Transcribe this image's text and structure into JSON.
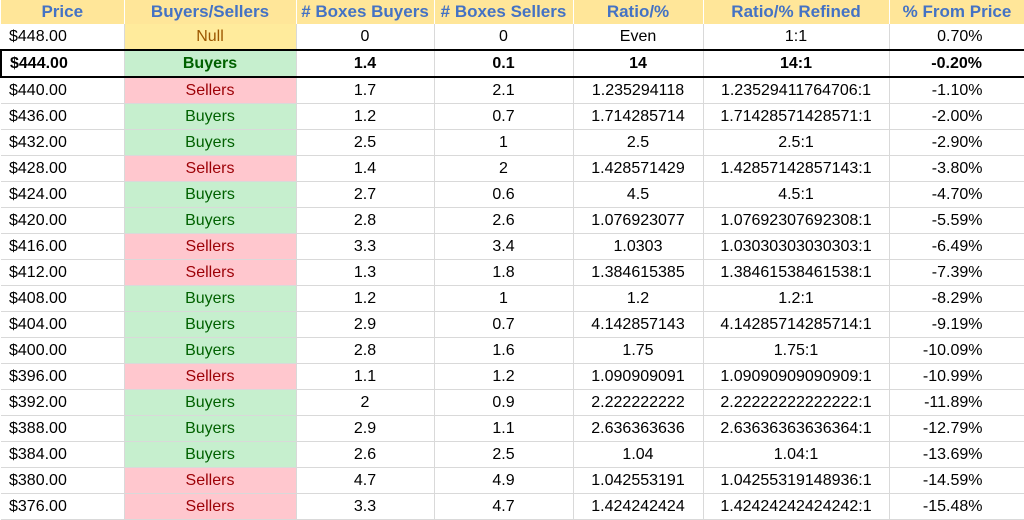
{
  "headers": [
    "Price",
    "Buyers/Sellers",
    "# Boxes Buyers",
    "# Boxes Sellers",
    "Ratio/%",
    "Ratio/% Refined",
    "% From Price"
  ],
  "rows": [
    {
      "price": "$448.00",
      "side": "Null",
      "buyers": "0",
      "sellers": "0",
      "ratio": "Even",
      "refined": "1:1",
      "pct": "0.70%"
    },
    {
      "price": "$444.00",
      "side": "Buyers",
      "buyers": "1.4",
      "sellers": "0.1",
      "ratio": "14",
      "refined": "14:1",
      "pct": "-0.20%"
    },
    {
      "price": "$440.00",
      "side": "Sellers",
      "buyers": "1.7",
      "sellers": "2.1",
      "ratio": "1.235294118",
      "refined": "1.23529411764706:1",
      "pct": "-1.10%"
    },
    {
      "price": "$436.00",
      "side": "Buyers",
      "buyers": "1.2",
      "sellers": "0.7",
      "ratio": "1.714285714",
      "refined": "1.71428571428571:1",
      "pct": "-2.00%"
    },
    {
      "price": "$432.00",
      "side": "Buyers",
      "buyers": "2.5",
      "sellers": "1",
      "ratio": "2.5",
      "refined": "2.5:1",
      "pct": "-2.90%"
    },
    {
      "price": "$428.00",
      "side": "Sellers",
      "buyers": "1.4",
      "sellers": "2",
      "ratio": "1.428571429",
      "refined": "1.42857142857143:1",
      "pct": "-3.80%"
    },
    {
      "price": "$424.00",
      "side": "Buyers",
      "buyers": "2.7",
      "sellers": "0.6",
      "ratio": "4.5",
      "refined": "4.5:1",
      "pct": "-4.70%"
    },
    {
      "price": "$420.00",
      "side": "Buyers",
      "buyers": "2.8",
      "sellers": "2.6",
      "ratio": "1.076923077",
      "refined": "1.07692307692308:1",
      "pct": "-5.59%"
    },
    {
      "price": "$416.00",
      "side": "Sellers",
      "buyers": "3.3",
      "sellers": "3.4",
      "ratio": "1.0303",
      "refined": "1.03030303030303:1",
      "pct": "-6.49%"
    },
    {
      "price": "$412.00",
      "side": "Sellers",
      "buyers": "1.3",
      "sellers": "1.8",
      "ratio": "1.384615385",
      "refined": "1.38461538461538:1",
      "pct": "-7.39%"
    },
    {
      "price": "$408.00",
      "side": "Buyers",
      "buyers": "1.2",
      "sellers": "1",
      "ratio": "1.2",
      "refined": "1.2:1",
      "pct": "-8.29%"
    },
    {
      "price": "$404.00",
      "side": "Buyers",
      "buyers": "2.9",
      "sellers": "0.7",
      "ratio": "4.142857143",
      "refined": "4.14285714285714:1",
      "pct": "-9.19%"
    },
    {
      "price": "$400.00",
      "side": "Buyers",
      "buyers": "2.8",
      "sellers": "1.6",
      "ratio": "1.75",
      "refined": "1.75:1",
      "pct": "-10.09%"
    },
    {
      "price": "$396.00",
      "side": "Sellers",
      "buyers": "1.1",
      "sellers": "1.2",
      "ratio": "1.090909091",
      "refined": "1.09090909090909:1",
      "pct": "-10.99%"
    },
    {
      "price": "$392.00",
      "side": "Buyers",
      "buyers": "2",
      "sellers": "0.9",
      "ratio": "2.222222222",
      "refined": "2.22222222222222:1",
      "pct": "-11.89%"
    },
    {
      "price": "$388.00",
      "side": "Buyers",
      "buyers": "2.9",
      "sellers": "1.1",
      "ratio": "2.636363636",
      "refined": "2.63636363636364:1",
      "pct": "-12.79%"
    },
    {
      "price": "$384.00",
      "side": "Buyers",
      "buyers": "2.6",
      "sellers": "2.5",
      "ratio": "1.04",
      "refined": "1.04:1",
      "pct": "-13.69%"
    },
    {
      "price": "$380.00",
      "side": "Sellers",
      "buyers": "4.7",
      "sellers": "4.9",
      "ratio": "1.042553191",
      "refined": "1.04255319148936:1",
      "pct": "-14.59%"
    },
    {
      "price": "$376.00",
      "side": "Sellers",
      "buyers": "3.3",
      "sellers": "4.7",
      "ratio": "1.424242424",
      "refined": "1.42424242424242:1",
      "pct": "-15.48%"
    }
  ],
  "highlight_row": 1,
  "colors": {
    "header_bg": "#ffe699",
    "header_text": "#4472c4",
    "buyers_bg": "#c6efce",
    "buyers_text": "#006100",
    "sellers_bg": "#ffc7ce",
    "sellers_text": "#9c0006",
    "null_bg": "#ffeb9c",
    "null_text": "#9c5700"
  }
}
